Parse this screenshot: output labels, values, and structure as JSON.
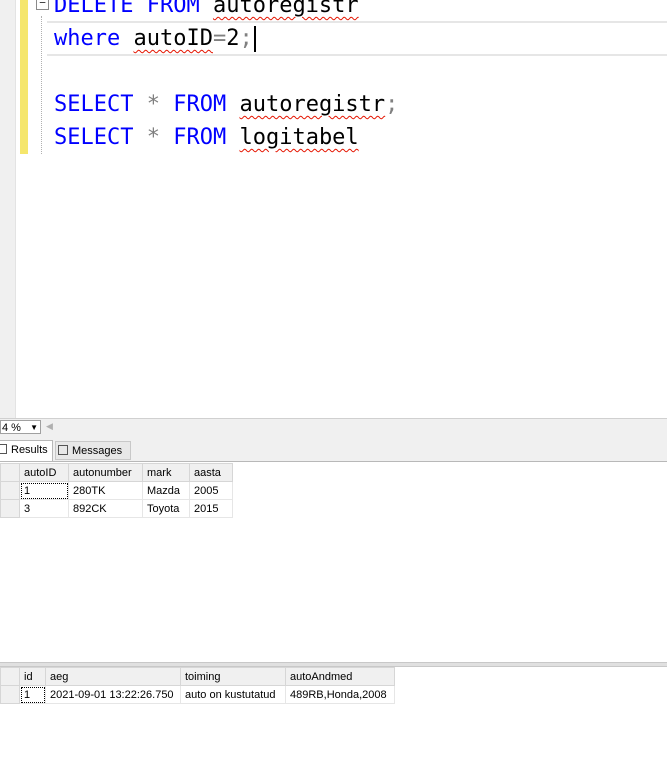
{
  "editor": {
    "lines": [
      {
        "tokens": [
          {
            "t": "DELETE",
            "c": "kw"
          },
          {
            "t": " "
          },
          {
            "t": "FROM",
            "c": "kw"
          },
          {
            "t": " "
          },
          {
            "t": "autoregistr",
            "c": "sq"
          }
        ]
      },
      {
        "tokens": [
          {
            "t": "where",
            "c": "kw"
          },
          {
            "t": " "
          },
          {
            "t": "autoID",
            "c": "sq"
          },
          {
            "t": "=",
            "c": "op"
          },
          {
            "t": "2"
          },
          {
            "t": ";",
            "c": "op"
          }
        ],
        "caret": true
      },
      {
        "tokens": []
      },
      {
        "tokens": [
          {
            "t": "SELECT",
            "c": "kw"
          },
          {
            "t": " "
          },
          {
            "t": "*",
            "c": "op"
          },
          {
            "t": " "
          },
          {
            "t": "FROM",
            "c": "kw"
          },
          {
            "t": " "
          },
          {
            "t": "autoregistr",
            "c": "sq"
          },
          {
            "t": ";",
            "c": "op"
          }
        ]
      },
      {
        "tokens": [
          {
            "t": "SELECT",
            "c": "kw"
          },
          {
            "t": " "
          },
          {
            "t": "*",
            "c": "op"
          },
          {
            "t": " "
          },
          {
            "t": "FROM",
            "c": "kw"
          },
          {
            "t": " "
          },
          {
            "t": "logitabel",
            "c": "sq"
          }
        ]
      }
    ],
    "fold_glyph": "−"
  },
  "zoom": {
    "value": "4 %"
  },
  "tabs": {
    "results": "Results",
    "messages": "Messages"
  },
  "grid1": {
    "columns": [
      "autoID",
      "autonumber",
      "mark",
      "aasta"
    ],
    "rows": [
      [
        "1",
        "280TK",
        "Mazda",
        "2005"
      ],
      [
        "3",
        "892CK",
        "Toyota",
        "2015"
      ]
    ]
  },
  "grid2": {
    "columns": [
      "id",
      "aeg",
      "toiming",
      "autoAndmed"
    ],
    "rows": [
      [
        "1",
        "2021-09-01 13:22:26.750",
        "auto on kustutatud",
        "489RB,Honda,2008"
      ]
    ]
  },
  "colors": {
    "keyword": "#0000ff",
    "operator": "#808080",
    "squiggle": "#e51400",
    "changebar": "#f5e66c"
  }
}
